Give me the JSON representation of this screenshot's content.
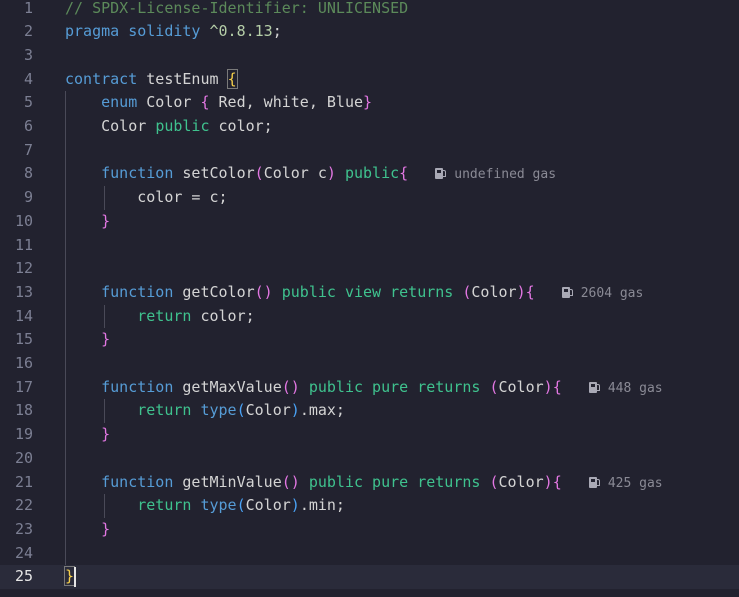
{
  "editor": {
    "colors": {
      "background": "#22222f",
      "comment": "#5c8a5a",
      "keyword": "#569cd6",
      "modifier": "#3fc28e",
      "text": "#d4d4d4",
      "number": "#b5cea8",
      "bracket_yellow": "#f7d04a",
      "bracket_pink": "#e377e3",
      "bracket_blue": "#4aa3f7",
      "hint": "#8a8a95"
    },
    "icons": {
      "gas": "fuel-pump-icon"
    },
    "current_line": 25,
    "lines": [
      {
        "n": "1",
        "tokens": [
          {
            "t": "// SPDX-License-Identifier: UNLICENSED",
            "c": "comment"
          }
        ]
      },
      {
        "n": "2",
        "tokens": [
          {
            "t": "pragma solidity ",
            "c": "keyword"
          },
          {
            "t": "^0.8.13",
            "c": "number"
          },
          {
            "t": ";",
            "c": "text"
          }
        ]
      },
      {
        "n": "3",
        "tokens": []
      },
      {
        "n": "4",
        "tokens": [
          {
            "t": "contract ",
            "c": "keyword"
          },
          {
            "t": "testEnum ",
            "c": "text"
          },
          {
            "t": "{",
            "c": "bracket_yellow",
            "box": true
          }
        ]
      },
      {
        "n": "5",
        "tokens": [
          {
            "t": "    enum ",
            "c": "keyword"
          },
          {
            "t": "Color ",
            "c": "text"
          },
          {
            "t": "{",
            "c": "bracket_pink"
          },
          {
            "t": " Red, white, Blue",
            "c": "text"
          },
          {
            "t": "}",
            "c": "bracket_pink"
          }
        ]
      },
      {
        "n": "6",
        "tokens": [
          {
            "t": "    Color ",
            "c": "text"
          },
          {
            "t": "public ",
            "c": "modifier"
          },
          {
            "t": "color;",
            "c": "text"
          }
        ]
      },
      {
        "n": "7",
        "tokens": []
      },
      {
        "n": "8",
        "tokens": [
          {
            "t": "    function ",
            "c": "keyword"
          },
          {
            "t": "setColor",
            "c": "text"
          },
          {
            "t": "(",
            "c": "bracket_pink"
          },
          {
            "t": "Color c",
            "c": "text"
          },
          {
            "t": ")",
            "c": "bracket_pink"
          },
          {
            "t": " public",
            "c": "modifier"
          },
          {
            "t": "{",
            "c": "bracket_pink"
          }
        ],
        "hint": "undefined gas"
      },
      {
        "n": "9",
        "tokens": [
          {
            "t": "        color = c;",
            "c": "text"
          }
        ]
      },
      {
        "n": "10",
        "tokens": [
          {
            "t": "    }",
            "c": "bracket_pink"
          }
        ]
      },
      {
        "n": "11",
        "tokens": []
      },
      {
        "n": "12",
        "tokens": []
      },
      {
        "n": "13",
        "tokens": [
          {
            "t": "    function ",
            "c": "keyword"
          },
          {
            "t": "getColor",
            "c": "text"
          },
          {
            "t": "()",
            "c": "bracket_pink"
          },
          {
            "t": " public view ",
            "c": "modifier"
          },
          {
            "t": "returns ",
            "c": "modifier"
          },
          {
            "t": "(",
            "c": "bracket_pink"
          },
          {
            "t": "Color",
            "c": "text"
          },
          {
            "t": ")",
            "c": "bracket_pink"
          },
          {
            "t": "{",
            "c": "bracket_pink"
          }
        ],
        "hint": "2604 gas"
      },
      {
        "n": "14",
        "tokens": [
          {
            "t": "        return ",
            "c": "modifier"
          },
          {
            "t": "color;",
            "c": "text"
          }
        ]
      },
      {
        "n": "15",
        "tokens": [
          {
            "t": "    }",
            "c": "bracket_pink"
          }
        ]
      },
      {
        "n": "16",
        "tokens": []
      },
      {
        "n": "17",
        "tokens": [
          {
            "t": "    function ",
            "c": "keyword"
          },
          {
            "t": "getMaxValue",
            "c": "text"
          },
          {
            "t": "()",
            "c": "bracket_pink"
          },
          {
            "t": " public pure ",
            "c": "modifier"
          },
          {
            "t": "returns ",
            "c": "modifier"
          },
          {
            "t": "(",
            "c": "bracket_pink"
          },
          {
            "t": "Color",
            "c": "text"
          },
          {
            "t": ")",
            "c": "bracket_pink"
          },
          {
            "t": "{",
            "c": "bracket_pink"
          }
        ],
        "hint": "448 gas"
      },
      {
        "n": "18",
        "tokens": [
          {
            "t": "        return ",
            "c": "modifier"
          },
          {
            "t": "type",
            "c": "keyword"
          },
          {
            "t": "(",
            "c": "bracket_blue"
          },
          {
            "t": "Color",
            "c": "text"
          },
          {
            "t": ")",
            "c": "bracket_blue"
          },
          {
            "t": ".max;",
            "c": "text"
          }
        ]
      },
      {
        "n": "19",
        "tokens": [
          {
            "t": "    }",
            "c": "bracket_pink"
          }
        ]
      },
      {
        "n": "20",
        "tokens": []
      },
      {
        "n": "21",
        "tokens": [
          {
            "t": "    function ",
            "c": "keyword"
          },
          {
            "t": "getMinValue",
            "c": "text"
          },
          {
            "t": "()",
            "c": "bracket_pink"
          },
          {
            "t": " public pure ",
            "c": "modifier"
          },
          {
            "t": "returns ",
            "c": "modifier"
          },
          {
            "t": "(",
            "c": "bracket_pink"
          },
          {
            "t": "Color",
            "c": "text"
          },
          {
            "t": ")",
            "c": "bracket_pink"
          },
          {
            "t": "{",
            "c": "bracket_pink"
          }
        ],
        "hint": "425 gas"
      },
      {
        "n": "22",
        "tokens": [
          {
            "t": "        return ",
            "c": "modifier"
          },
          {
            "t": "type",
            "c": "keyword"
          },
          {
            "t": "(",
            "c": "bracket_blue"
          },
          {
            "t": "Color",
            "c": "text"
          },
          {
            "t": ")",
            "c": "bracket_blue"
          },
          {
            "t": ".min;",
            "c": "text"
          }
        ]
      },
      {
        "n": "23",
        "tokens": [
          {
            "t": "    }",
            "c": "bracket_pink"
          }
        ]
      },
      {
        "n": "24",
        "tokens": []
      },
      {
        "n": "25",
        "tokens": [
          {
            "t": "}",
            "c": "bracket_yellow",
            "box": true
          }
        ]
      }
    ]
  }
}
